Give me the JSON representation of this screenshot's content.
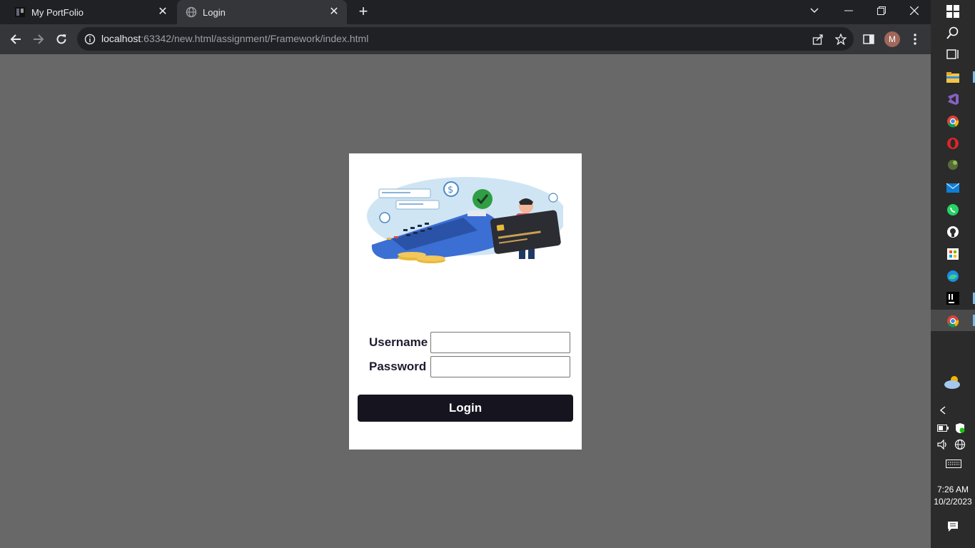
{
  "tabs": [
    {
      "title": "My PortFolio",
      "favicon": "portfolio-favicon",
      "close": "✕"
    },
    {
      "title": "Login",
      "favicon": "globe-icon",
      "close": "✕"
    }
  ],
  "newtab": "+",
  "window_controls": {
    "minimize": "—",
    "restore": "❐",
    "close": "✕"
  },
  "address": {
    "host": "localhost",
    "path": ":63342/new.html/assignment/Framework/index.html"
  },
  "profile_initial": "M",
  "login": {
    "username_label": "Username",
    "password_label": "Password",
    "username_value": "",
    "password_value": "",
    "button_label": "Login"
  },
  "clock": {
    "time": "7:26 AM",
    "date": "10/2/2023"
  },
  "colors": {
    "button": "#16141f",
    "page_bg": "#686868",
    "card_bg": "#ffffff"
  }
}
